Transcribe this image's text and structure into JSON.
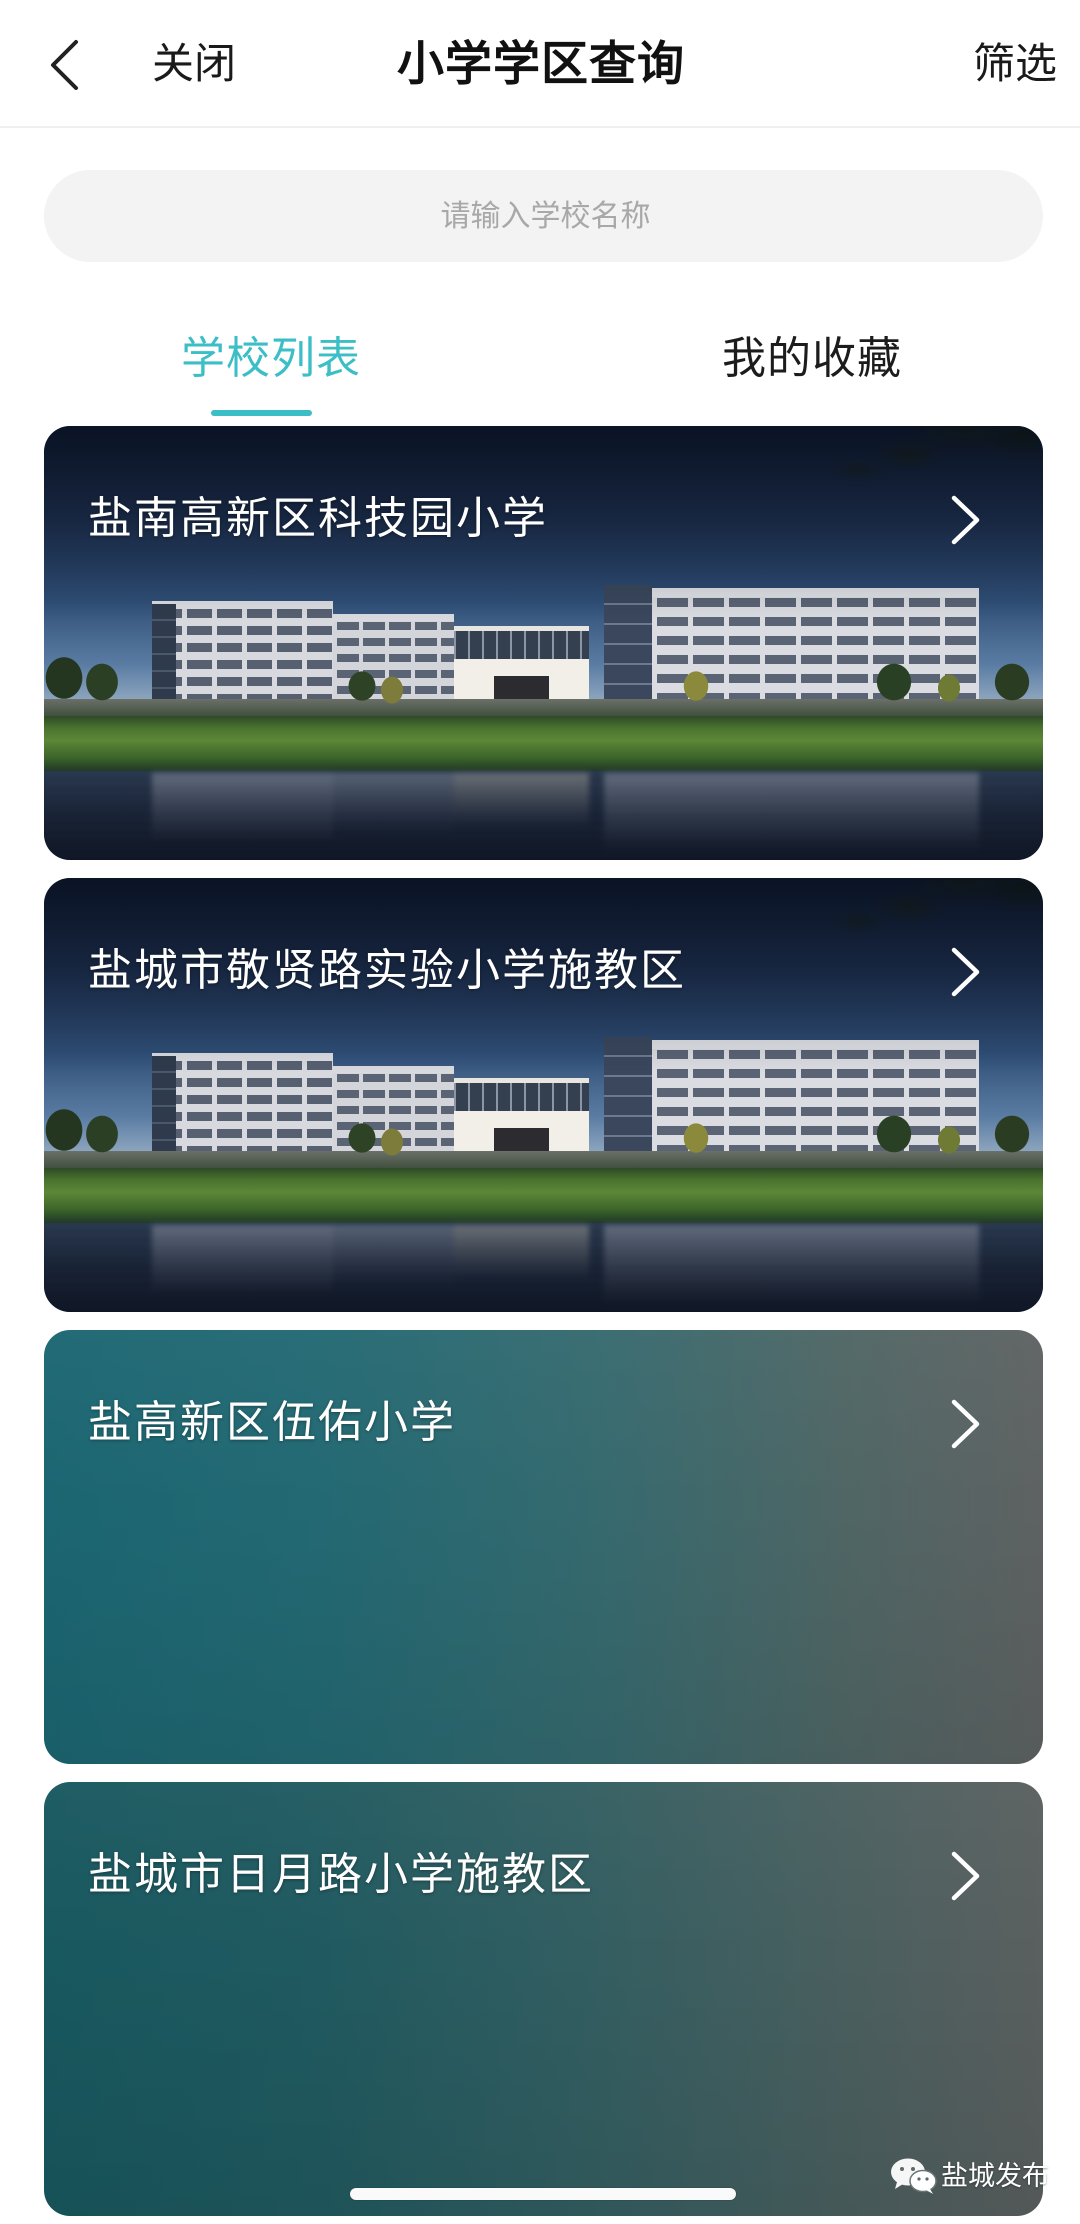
{
  "header": {
    "back_icon": "chevron-left-icon",
    "close_label": "关闭",
    "title": "小学学区查询",
    "filter_label": "筛选"
  },
  "search": {
    "placeholder": "请输入学校名称",
    "value": ""
  },
  "tabs": [
    {
      "label": "学校列表",
      "active": true
    },
    {
      "label": "我的收藏",
      "active": false
    }
  ],
  "schools": [
    {
      "name": "盐南高新区科技园小学",
      "icon": "chevron-right-icon"
    },
    {
      "name": "盐城市敬贤路实验小学施教区",
      "icon": "chevron-right-icon"
    },
    {
      "name": "盐高新区伍佑小学",
      "icon": "chevron-right-icon"
    },
    {
      "name": "盐城市日月路小学施教区",
      "icon": "chevron-right-icon"
    }
  ],
  "watermark": {
    "icon": "wechat-icon",
    "label": "盐城发布"
  },
  "colors": {
    "accent": "#3cbec7",
    "text_primary": "#1a1a1a",
    "placeholder": "#a8a8a8",
    "search_background": "#f3f3f3",
    "card_gradient_start": "#1b6672",
    "card_gradient_end": "#5e6262"
  }
}
